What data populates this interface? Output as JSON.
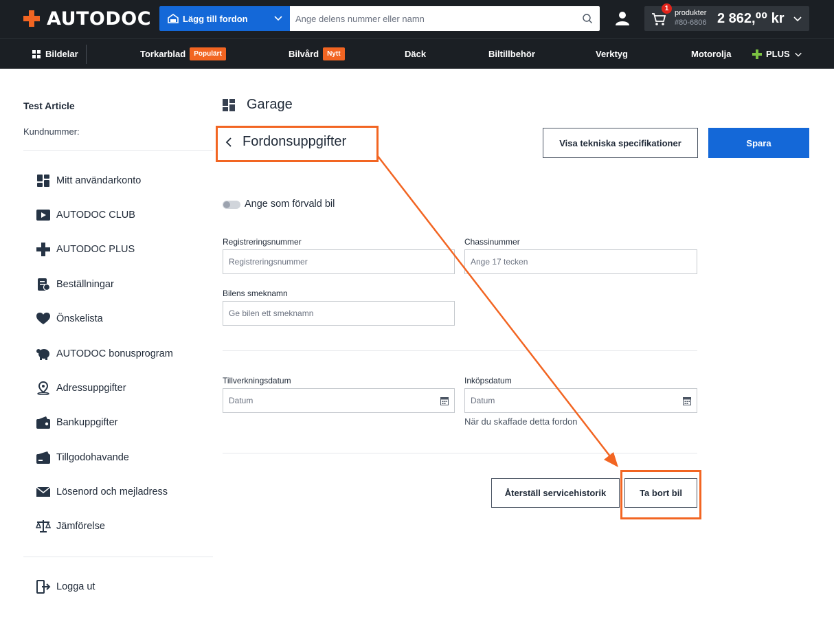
{
  "header": {
    "logo": "AUTODOC",
    "add_vehicle": "Lägg till fordon",
    "search_placeholder": "Ange delens nummer eller namn",
    "cart_badge": "1",
    "cart_products": "produkter",
    "cart_order": "#80-6806",
    "cart_total": "2 862,⁰⁰ kr"
  },
  "nav": {
    "items": [
      "Bildelar",
      "Torkarblad",
      "Bilvård",
      "Däck",
      "Biltillbehör",
      "Verktyg",
      "Motorolja",
      "PLUS"
    ],
    "tag_popular": "Populärt",
    "tag_new": "Nytt"
  },
  "sidebar": {
    "name": "Test Article",
    "customer_label": "Kundnummer:",
    "items": [
      "Mitt användarkonto",
      "AUTODOC CLUB",
      "AUTODOC PLUS",
      "Beställningar",
      "Önskelista",
      "AUTODOC bonusprogram",
      "Adressuppgifter",
      "Bankuppgifter",
      "Tillgodohavande",
      "Lösenord och mejladress",
      "Jämförelse"
    ],
    "logout": "Logga ut"
  },
  "main": {
    "title": "Garage",
    "section": "Fordonsuppgifter",
    "tech_button": "Visa tekniska specifikationer",
    "save_button": "Spara",
    "default_toggle": "Ange som förvald bil",
    "reg_label": "Registreringsnummer",
    "reg_placeholder": "Registreringsnummer",
    "vin_label": "Chassinummer",
    "vin_placeholder": "Ange 17 tecken",
    "nick_label": "Bilens smeknamn",
    "nick_placeholder": "Ge bilen ett smeknamn",
    "mfg_label": "Tillverkningsdatum",
    "mfg_placeholder": "Datum",
    "buy_label": "Inköpsdatum",
    "buy_placeholder": "Datum",
    "buy_hint": "När du skaffade detta fordon",
    "reset_button": "Återställ servicehistorik",
    "delete_button": "Ta bort bil"
  },
  "colors": {
    "accent": "#f26522",
    "primary": "#1468d8",
    "header_bg": "#1b1f24"
  }
}
